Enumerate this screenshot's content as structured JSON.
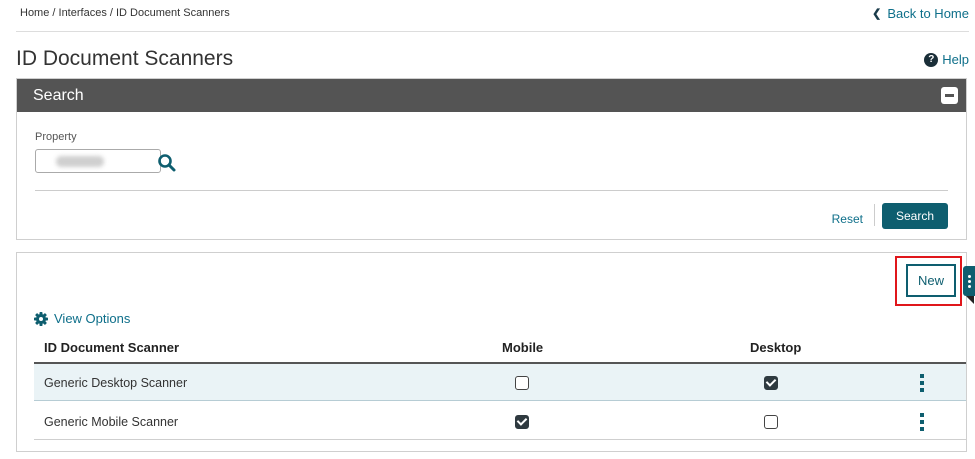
{
  "breadcrumb": "Home / Interfaces / ID Document Scanners",
  "back_link": "Back to Home",
  "page_title": "ID Document Scanners",
  "help_label": "Help",
  "search_panel": {
    "title": "Search",
    "property_label": "Property",
    "property_value": "",
    "reset_label": "Reset",
    "search_label": "Search"
  },
  "results": {
    "new_label": "New",
    "view_options_label": "View Options",
    "columns": [
      "ID Document Scanner",
      "Mobile",
      "Desktop"
    ],
    "rows": [
      {
        "name": "Generic Desktop Scanner",
        "mobile": false,
        "desktop": true,
        "selected": true
      },
      {
        "name": "Generic Mobile Scanner",
        "mobile": true,
        "desktop": false,
        "selected": false
      }
    ]
  },
  "colors": {
    "accent": "#0e5e6f",
    "link": "#0e6f8a",
    "header_bar": "#545454",
    "highlight_border": "#e0161b",
    "selected_row": "#eaf3f6"
  }
}
